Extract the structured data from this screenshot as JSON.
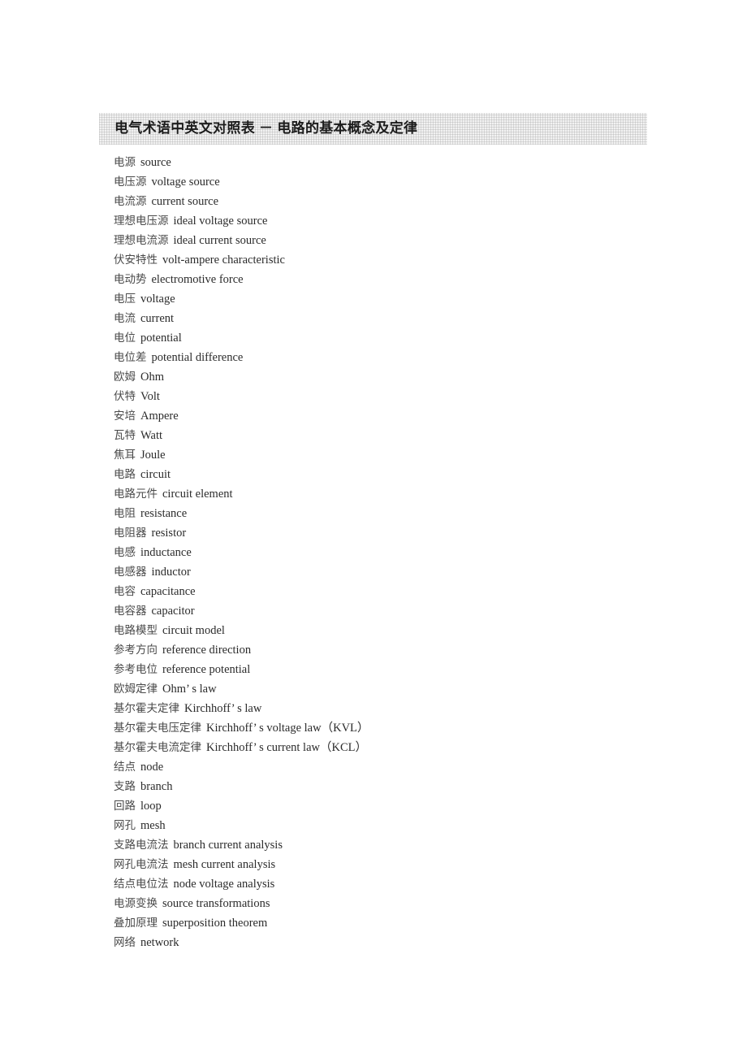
{
  "document": {
    "heading": "电气术语中英文对照表 － 电路的基本概念及定律",
    "heading_band_color": "#f2f2f2",
    "body_text_color": "#2b2b2b",
    "chinese_text_color": "#4a4a4a"
  },
  "terms": [
    {
      "cn": "电源",
      "en": "source"
    },
    {
      "cn": "电压源",
      "en": "voltage source"
    },
    {
      "cn": "电流源",
      "en": "current source"
    },
    {
      "cn": "理想电压源",
      "en": "ideal voltage source"
    },
    {
      "cn": "理想电流源",
      "en": "ideal current source"
    },
    {
      "cn": "伏安特性",
      "en": "volt-ampere characteristic"
    },
    {
      "cn": "电动势",
      "en": "electromotive force"
    },
    {
      "cn": "电压",
      "en": "voltage"
    },
    {
      "cn": "电流",
      "en": "current"
    },
    {
      "cn": "电位",
      "en": "potential"
    },
    {
      "cn": "电位差",
      "en": "potential difference"
    },
    {
      "cn": "欧姆",
      "en": "Ohm"
    },
    {
      "cn": "伏特",
      "en": "Volt"
    },
    {
      "cn": "安培",
      "en": "Ampere"
    },
    {
      "cn": "瓦特",
      "en": "Watt"
    },
    {
      "cn": "焦耳",
      "en": "Joule"
    },
    {
      "cn": "电路",
      "en": "circuit"
    },
    {
      "cn": "电路元件",
      "en": "circuit element"
    },
    {
      "cn": "电阻",
      "en": "resistance"
    },
    {
      "cn": "电阻器",
      "en": "resistor"
    },
    {
      "cn": "电感",
      "en": "inductance"
    },
    {
      "cn": "电感器",
      "en": "inductor"
    },
    {
      "cn": "电容",
      "en": "capacitance"
    },
    {
      "cn": "电容器",
      "en": "capacitor"
    },
    {
      "cn": "电路模型",
      "en": "circuit model"
    },
    {
      "cn": "参考方向",
      "en": "reference direction"
    },
    {
      "cn": "参考电位",
      "en": "reference potential"
    },
    {
      "cn": "欧姆定律",
      "en": "Ohm’ s law"
    },
    {
      "cn": "基尔霍夫定律",
      "en": "Kirchhoff’ s law"
    },
    {
      "cn": "基尔霍夫电压定律",
      "en": "Kirchhoff’ s voltage law（KVL）"
    },
    {
      "cn": "基尔霍夫电流定律",
      "en": "Kirchhoff’ s current law（KCL）"
    },
    {
      "cn": "结点",
      "en": "node"
    },
    {
      "cn": "支路",
      "en": "branch"
    },
    {
      "cn": "回路",
      "en": "loop"
    },
    {
      "cn": "网孔",
      "en": "mesh"
    },
    {
      "cn": "支路电流法",
      "en": "branch current analysis"
    },
    {
      "cn": "网孔电流法",
      "en": "mesh current analysis"
    },
    {
      "cn": "结点电位法",
      "en": "node voltage analysis"
    },
    {
      "cn": "电源变换",
      "en": "source transformations"
    },
    {
      "cn": "叠加原理",
      "en": "superposition theorem"
    },
    {
      "cn": "网络",
      "en": "network"
    }
  ]
}
